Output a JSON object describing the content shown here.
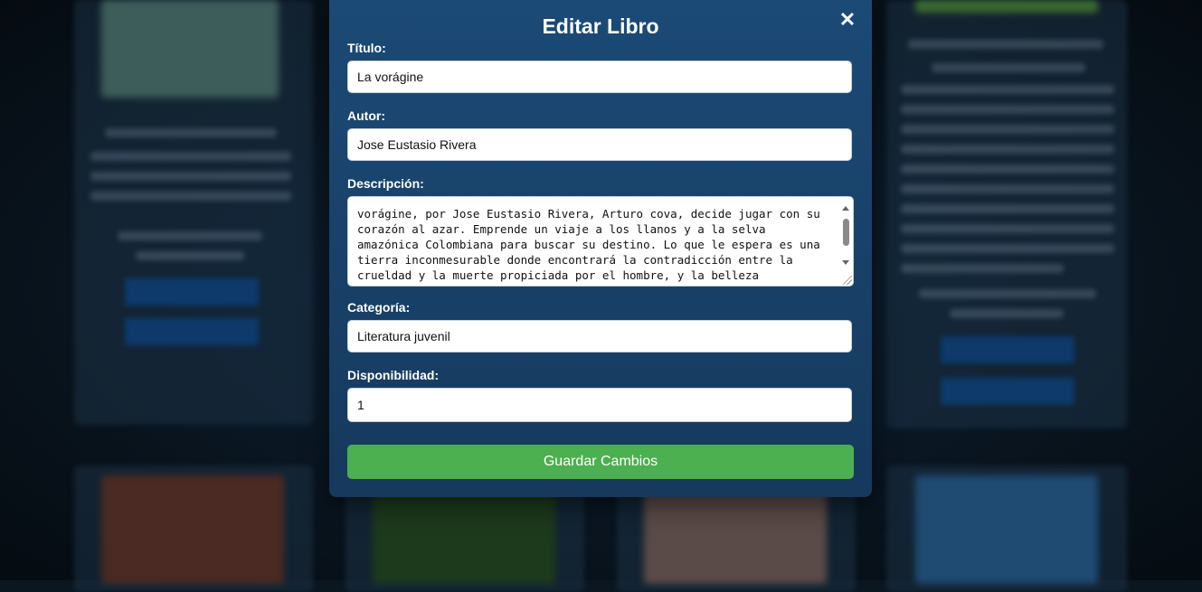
{
  "modal": {
    "title": "Editar Libro",
    "close_icon": "close-icon",
    "close_glyph": "✕"
  },
  "form": {
    "titulo": {
      "label": "Título:",
      "value": "La vorágine"
    },
    "autor": {
      "label": "Autor:",
      "value": "Jose Eustasio Rivera"
    },
    "descripcion": {
      "label": "Descripción:",
      "value": "vorágine, por Jose Eustasio Rivera, Arturo cova, decide jugar con su corazón al azar. Emprende un viaje a los llanos y a la selva amazónica Colombiana para buscar su destino. Lo que le espera es una tierra inconmesurable donde encontrará la contradicción entre la crueldad y la muerte propiciada por el hombre, y la belleza"
    },
    "categoria": {
      "label": "Categoría:",
      "value": "Literatura juvenil"
    },
    "disponibilidad": {
      "label": "Disponibilidad:",
      "value": "1"
    },
    "save_label": "Guardar Cambios"
  },
  "colors": {
    "modal_bg": "#1b4a76",
    "save_button": "#4caf50",
    "backdrop": "#0a1620"
  }
}
